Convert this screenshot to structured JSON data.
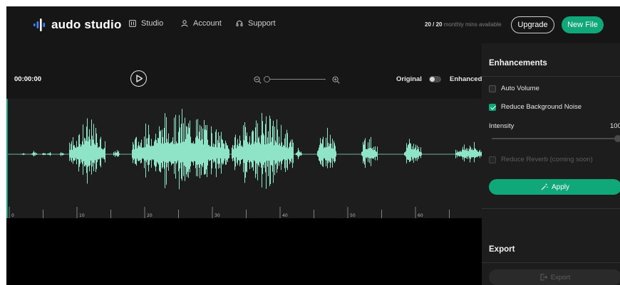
{
  "app": {
    "logo_text": "audo studio",
    "accent_color": "#10a878"
  },
  "nav": {
    "items": [
      {
        "label": "Studio",
        "icon": "studio-icon"
      },
      {
        "label": "Account",
        "icon": "user-icon"
      },
      {
        "label": "Support",
        "icon": "headset-icon"
      }
    ]
  },
  "header": {
    "minutes_used": "20 / 20",
    "minutes_suffix": "monthly mins available",
    "upgrade_label": "Upgrade",
    "new_file_label": "New File"
  },
  "player": {
    "time": "00:00:00",
    "original_label": "Original",
    "enhanced_label": "Enhanced",
    "enhanced_on": false
  },
  "timeline": {
    "tick_labels": [
      "0",
      "10",
      "20",
      "30",
      "40",
      "50",
      "60"
    ]
  },
  "enhancements": {
    "title": "Enhancements",
    "options": [
      {
        "label": "Auto Volume",
        "checked": false,
        "disabled": false
      },
      {
        "label": "Reduce Background Noise",
        "checked": true,
        "disabled": false
      },
      {
        "label": "Reduce Reverb (coming soon)",
        "checked": false,
        "disabled": true
      }
    ],
    "intensity_label": "Intensity",
    "intensity_value": "100",
    "intensity_fraction": 1.0,
    "apply_label": "Apply"
  },
  "export": {
    "title": "Export",
    "export_label": "Export"
  }
}
